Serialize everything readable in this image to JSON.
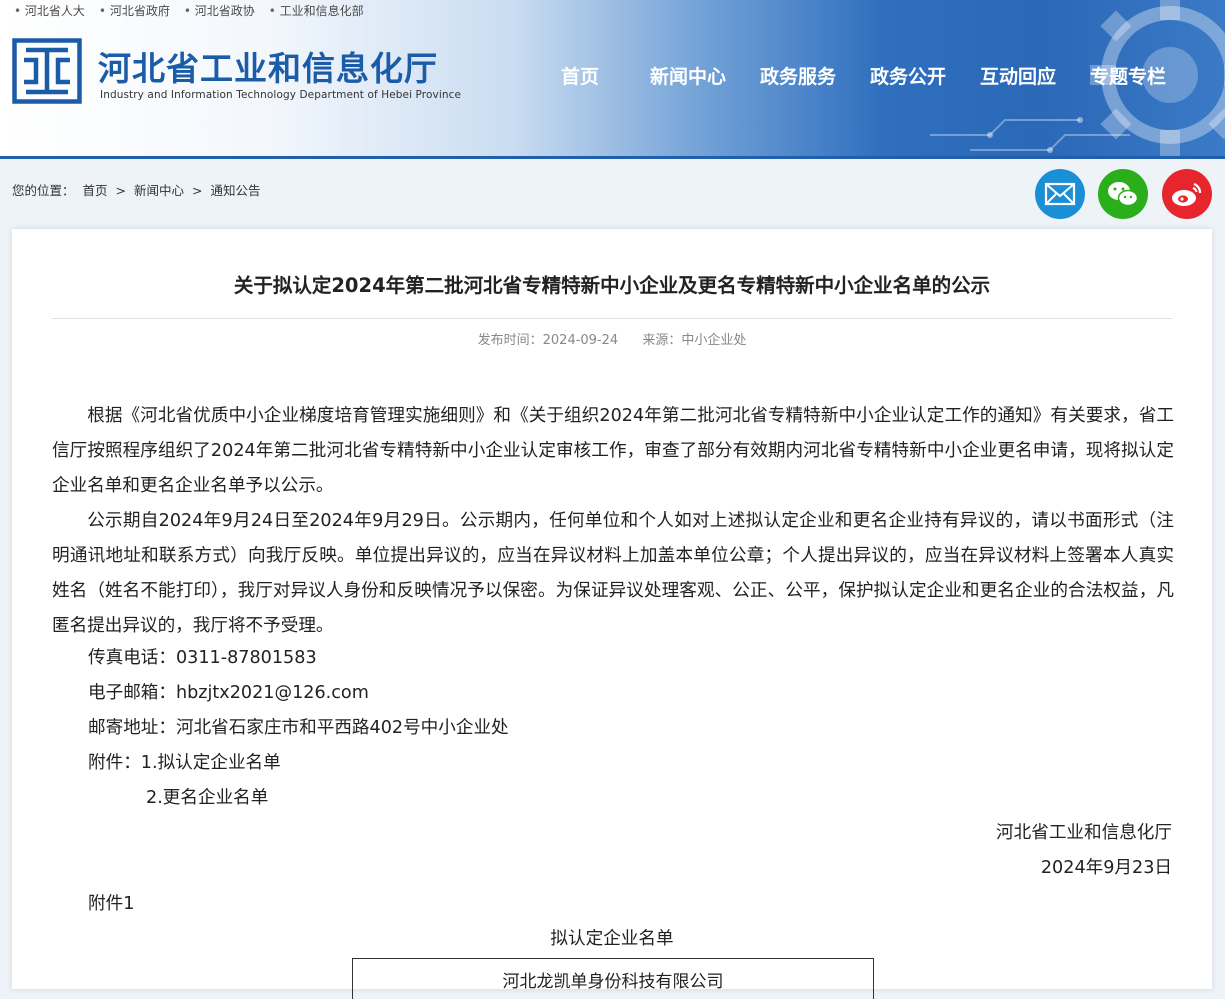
{
  "top_links": [
    "河北省人大",
    "河北省政府",
    "河北省政协",
    "工业和信息化部"
  ],
  "logo": {
    "title_cn": "河北省工业和信息化厅",
    "title_en": "Industry and Information Technology Department of Hebei Province"
  },
  "nav": [
    "首页",
    "新闻中心",
    "政务服务",
    "政务公开",
    "互动回应",
    "专题专栏"
  ],
  "breadcrumb": {
    "label": "您的位置：",
    "items": [
      "首页",
      ">",
      "新闻中心",
      ">",
      "通知公告"
    ]
  },
  "share_icons": [
    "email-icon",
    "wechat-icon",
    "weibo-icon"
  ],
  "colors": {
    "brand_blue": "#1a5ca8",
    "email": "#1a8fd6",
    "wechat": "#2aae1a",
    "weibo": "#e6262c"
  },
  "article": {
    "title": "关于拟认定2024年第二批河北省专精特新中小企业及更名专精特新中小企业名单的公示",
    "publish_label": "发布时间：2024-09-24",
    "source_label": "来源：中小企业处",
    "paragraphs": [
      "根据《河北省优质中小企业梯度培育管理实施细则》和《关于组织2024年第二批河北省专精特新中小企业认定工作的通知》有关要求，省工信厅按照程序组织了2024年第二批河北省专精特新中小企业认定审核工作，审查了部分有效期内河北省专精特新中小企业更名申请，现将拟认定企业名单和更名企业名单予以公示。",
      "公示期自2024年9月24日至2024年9月29日。公示期内，任何单位和个人如对上述拟认定企业和更名企业持有异议的，请以书面形式（注明通讯地址和联系方式）向我厅反映。单位提出异议的，应当在异议材料上加盖本单位公章；个人提出异议的，应当在异议材料上签署本人真实姓名（姓名不能打印），我厅对异议人身份和反映情况予以保密。为保证异议处理客观、公正、公平，保护拟认定企业和更名企业的合法权益，凡匿名提出异议的，我厅将不予受理。"
    ],
    "fax": "传真电话：0311-87801583",
    "email": "电子邮箱：hbzjtx2021@126.com",
    "address": "邮寄地址：河北省石家庄市和平西路402号中小企业处",
    "attachment_1": "附件：1.拟认定企业名单",
    "attachment_2": "2.更名企业名单",
    "signature_org": "河北省工业和信息化厅",
    "signature_date": "2024年9月23日",
    "annex_label": "附件1",
    "annex_title": "拟认定企业名单",
    "table_first_row": "河北龙凯单身份科技有限公司"
  }
}
